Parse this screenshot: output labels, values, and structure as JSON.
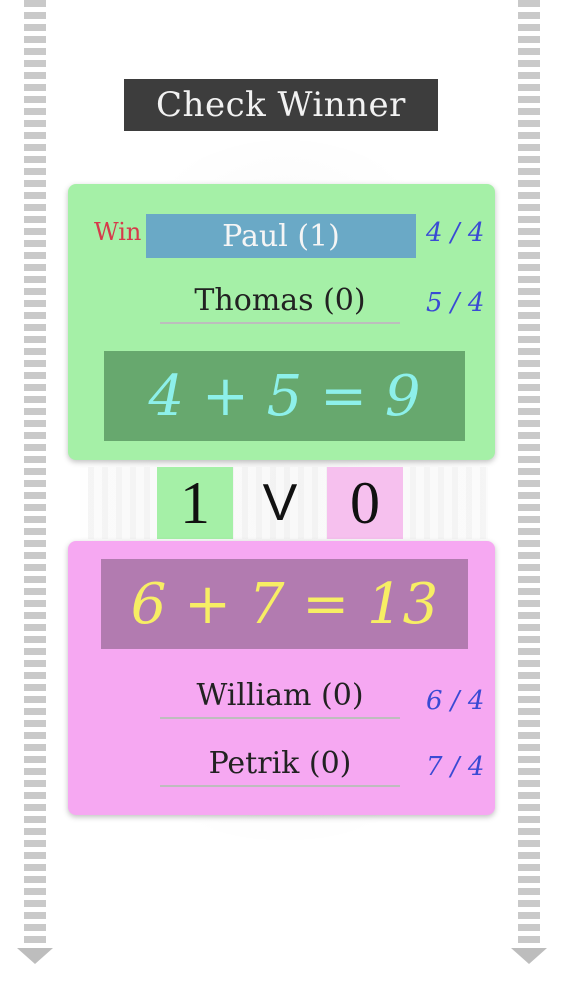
{
  "header": {
    "title": "Check Winner"
  },
  "team_a": {
    "win_label": "Win",
    "players": [
      {
        "name": "Paul (1)",
        "ratio": "4 / 4",
        "winner": true
      },
      {
        "name": "Thomas (0)",
        "ratio": "5 / 4",
        "winner": false
      }
    ],
    "sum": "4 + 5 = 9"
  },
  "score": {
    "left": "1",
    "versus": "V",
    "right": "0"
  },
  "team_b": {
    "sum": "6 + 7 = 13",
    "players": [
      {
        "name": "William (0)",
        "ratio": "6 / 4"
      },
      {
        "name": "Petrik (0)",
        "ratio": "7 / 4"
      }
    ]
  },
  "colors": {
    "team_a_bg": "#a5f0a7",
    "team_b_bg": "#f6a8f2",
    "winner_highlight": "#6aa9c6",
    "win_label": "#d63a4a",
    "ratio_text": "#3a4ad4"
  },
  "icons": {
    "scroll_down_left": "chevron-down-icon",
    "scroll_down_right": "chevron-down-icon"
  }
}
